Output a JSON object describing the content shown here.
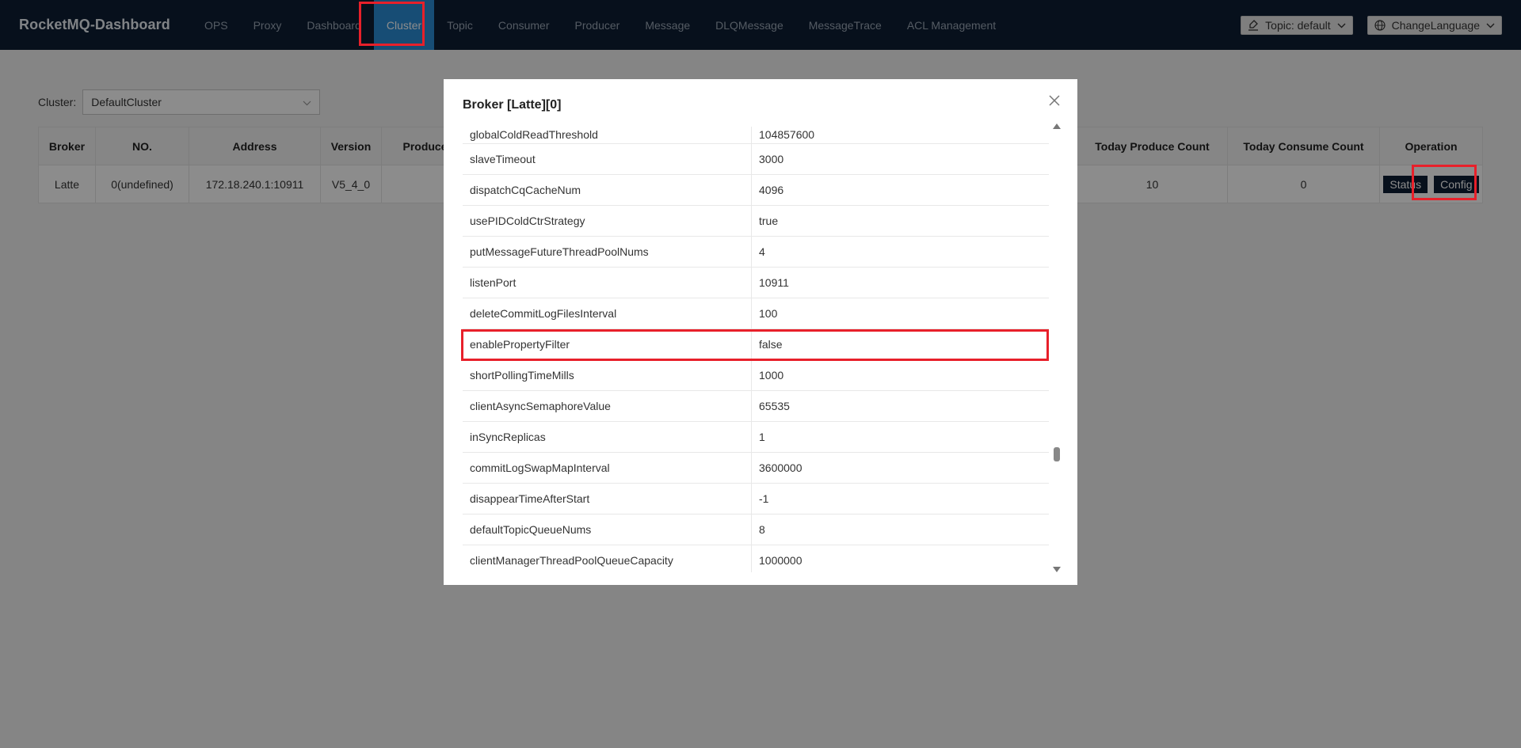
{
  "brand": "RocketMQ-Dashboard",
  "nav": {
    "items": [
      {
        "label": "OPS",
        "active": false
      },
      {
        "label": "Proxy",
        "active": false
      },
      {
        "label": "Dashboard",
        "active": false
      },
      {
        "label": "Cluster",
        "active": true
      },
      {
        "label": "Topic",
        "active": false
      },
      {
        "label": "Consumer",
        "active": false
      },
      {
        "label": "Producer",
        "active": false
      },
      {
        "label": "Message",
        "active": false
      },
      {
        "label": "DLQMessage",
        "active": false
      },
      {
        "label": "MessageTrace",
        "active": false
      },
      {
        "label": "ACL Management",
        "active": false
      }
    ],
    "topic_dropdown": "Topic: default",
    "language_dropdown": "ChangeLanguage"
  },
  "cluster": {
    "label": "Cluster:",
    "selected": "DefaultCluster"
  },
  "broker_table": {
    "headers": [
      "Broker",
      "NO.",
      "Address",
      "Version",
      "Produce",
      "",
      "Today Produce Count",
      "Today Consume Count",
      "Operation"
    ],
    "rows": [
      {
        "broker": "Latte",
        "no": "0(undefined)",
        "address": "172.18.240.1:10911",
        "version": "V5_4_0",
        "produce": "",
        "mid": "",
        "today_produce": "10",
        "today_consume": "0"
      }
    ],
    "status_button": "Status",
    "config_button": "Config"
  },
  "modal": {
    "title": "Broker [Latte][0]",
    "config_rows": [
      {
        "key": "globalColdReadThreshold",
        "value": "104857600"
      },
      {
        "key": "slaveTimeout",
        "value": "3000"
      },
      {
        "key": "dispatchCqCacheNum",
        "value": "4096"
      },
      {
        "key": "usePIDColdCtrStrategy",
        "value": "true"
      },
      {
        "key": "putMessageFutureThreadPoolNums",
        "value": "4"
      },
      {
        "key": "listenPort",
        "value": "10911"
      },
      {
        "key": "deleteCommitLogFilesInterval",
        "value": "100"
      },
      {
        "key": "enablePropertyFilter",
        "value": "false"
      },
      {
        "key": "shortPollingTimeMills",
        "value": "1000"
      },
      {
        "key": "clientAsyncSemaphoreValue",
        "value": "65535"
      },
      {
        "key": "inSyncReplicas",
        "value": "1"
      },
      {
        "key": "commitLogSwapMapInterval",
        "value": "3600000"
      },
      {
        "key": "disappearTimeAfterStart",
        "value": "-1"
      },
      {
        "key": "defaultTopicQueueNums",
        "value": "8"
      },
      {
        "key": "clientManagerThreadPoolQueueCapacity",
        "value": "1000000"
      }
    ]
  },
  "colors": {
    "navbar": "#0e1e33",
    "nav_active": "#2a8cd6",
    "highlight": "#e8202a"
  }
}
